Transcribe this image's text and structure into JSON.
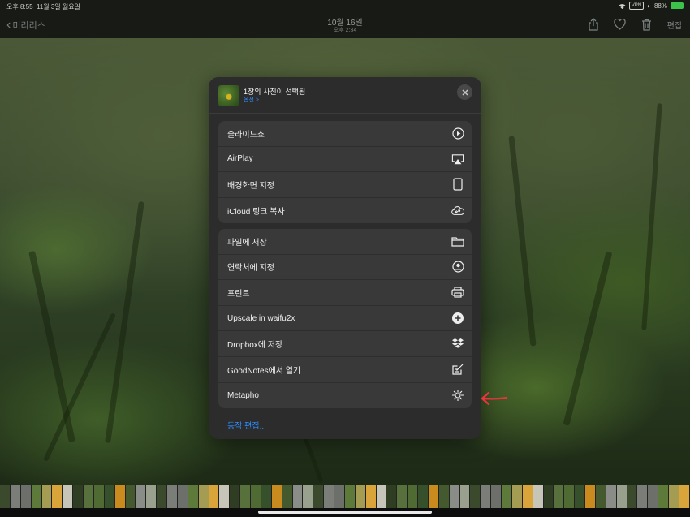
{
  "status": {
    "time": "오후 8:55",
    "date": "11월 3일 월요일",
    "vpn": "VPN",
    "battery_pct": "88%"
  },
  "nav": {
    "back_label": "미리리스",
    "title": "10월 16일",
    "subtitle": "오후 2:34",
    "edit_label": "편집",
    "icons": [
      "share-icon",
      "heart-icon",
      "trash-icon"
    ]
  },
  "sheet": {
    "title": "1장의 사진이 선택됨",
    "options_label": "옵션 >",
    "groups": [
      {
        "items": [
          {
            "label": "슬라이드쇼",
            "icon": "play-circle-icon"
          },
          {
            "label": "AirPlay",
            "icon": "airplay-icon"
          },
          {
            "label": "배경화면 지정",
            "icon": "ipad-icon"
          },
          {
            "label": "iCloud 링크 복사",
            "icon": "icloud-link-icon"
          }
        ]
      },
      {
        "items": [
          {
            "label": "파일에 저장",
            "icon": "folder-icon"
          },
          {
            "label": "연락처에 지정",
            "icon": "person-circle-icon"
          },
          {
            "label": "프린트",
            "icon": "printer-icon"
          },
          {
            "label": "Upscale in waifu2x",
            "icon": "plus-magnify-icon"
          },
          {
            "label": "Dropbox에 저장",
            "icon": "dropbox-icon"
          },
          {
            "label": "GoodNotes에서 열기",
            "icon": "compose-icon"
          },
          {
            "label": "Metapho",
            "icon": "aperture-icon"
          }
        ]
      }
    ],
    "edit_actions_label": "동작 편집..."
  },
  "colors": {
    "accent": "#2f8cff",
    "sheet_bg": "#2b2c2b",
    "row_bg": "#393939",
    "annotation_arrow": "#e8353d"
  }
}
